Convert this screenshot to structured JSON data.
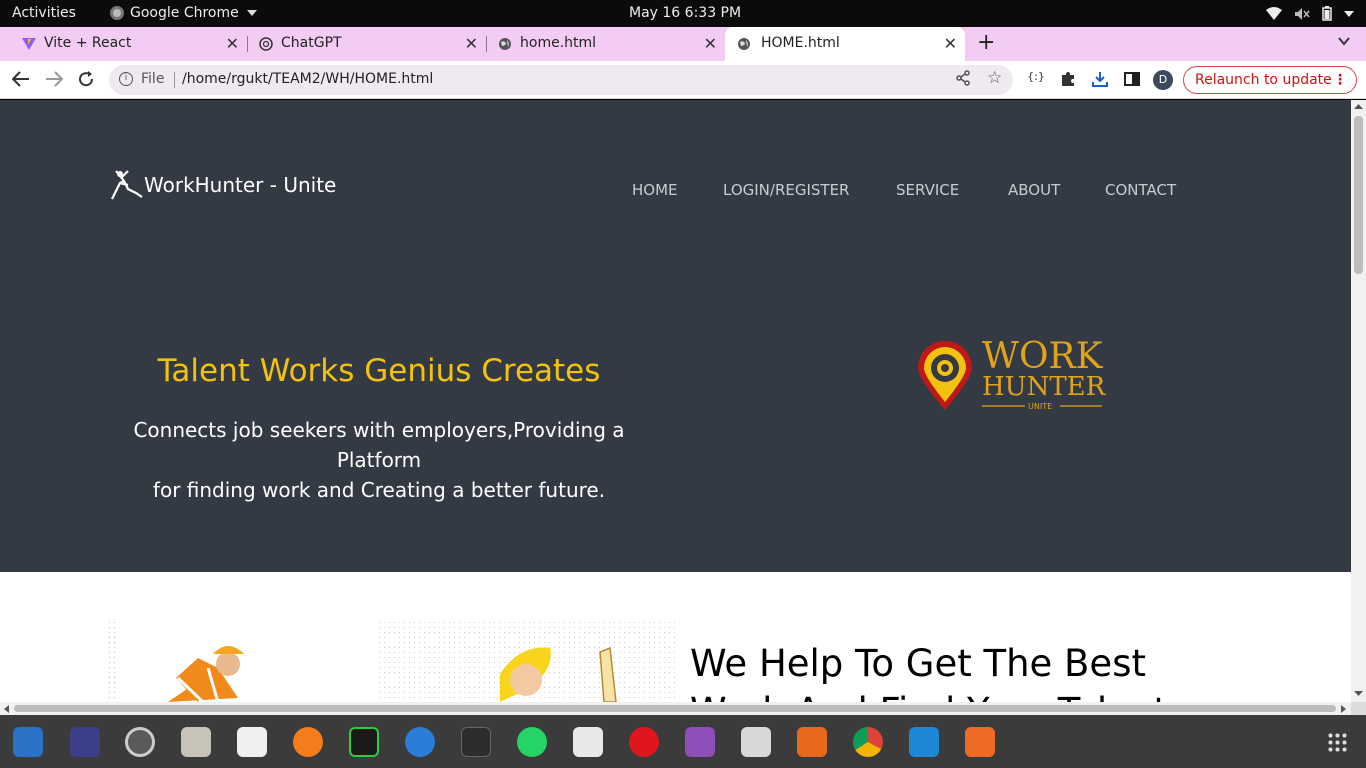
{
  "topbar": {
    "activities": "Activities",
    "app": "Google Chrome",
    "clock": "May 16  6:33 PM"
  },
  "tabs": [
    {
      "title": "Vite + React"
    },
    {
      "title": "ChatGPT"
    },
    {
      "title": "home.html"
    },
    {
      "title": "HOME.html"
    }
  ],
  "toolbar": {
    "scheme": "File",
    "url": "/home/rgukt/TEAM2/WH/HOME.html",
    "avatar": "D",
    "relaunch": "Relaunch to update"
  },
  "site": {
    "brand": "WorkHunter - Unite",
    "nav": [
      "HOME",
      "LOGIN/REGISTER",
      "SERVICE",
      "ABOUT",
      "CONTACT"
    ],
    "tagline": "Talent Works Genius Creates",
    "desc_line1": "Connects job seekers with employers,Providing a Platform",
    "desc_line2": "for finding work and Creating a better future.",
    "logo_work": "WORK",
    "logo_hunter": "HUNTER",
    "logo_unite": "UNITE",
    "help_line1": "We Help To Get The Best",
    "help_line2": "Work And Find Your Talent"
  },
  "colors": {
    "hero_bg": "#343a44",
    "accent": "#f2c20f",
    "tab_strip": "#f2ccf3"
  },
  "dock": [
    "writer-icon",
    "texstudio-icon",
    "settings-icon",
    "files-icon",
    "text-editor-icon",
    "firefox-icon",
    "terminal-green-icon",
    "thunderbird-icon",
    "terminal-icon",
    "whatsapp-icon",
    "document-viewer-icon",
    "alert-icon",
    "video-icon",
    "image-viewer-icon",
    "presentation-icon",
    "chrome-icon",
    "vscode-icon",
    "app-store-icon"
  ]
}
